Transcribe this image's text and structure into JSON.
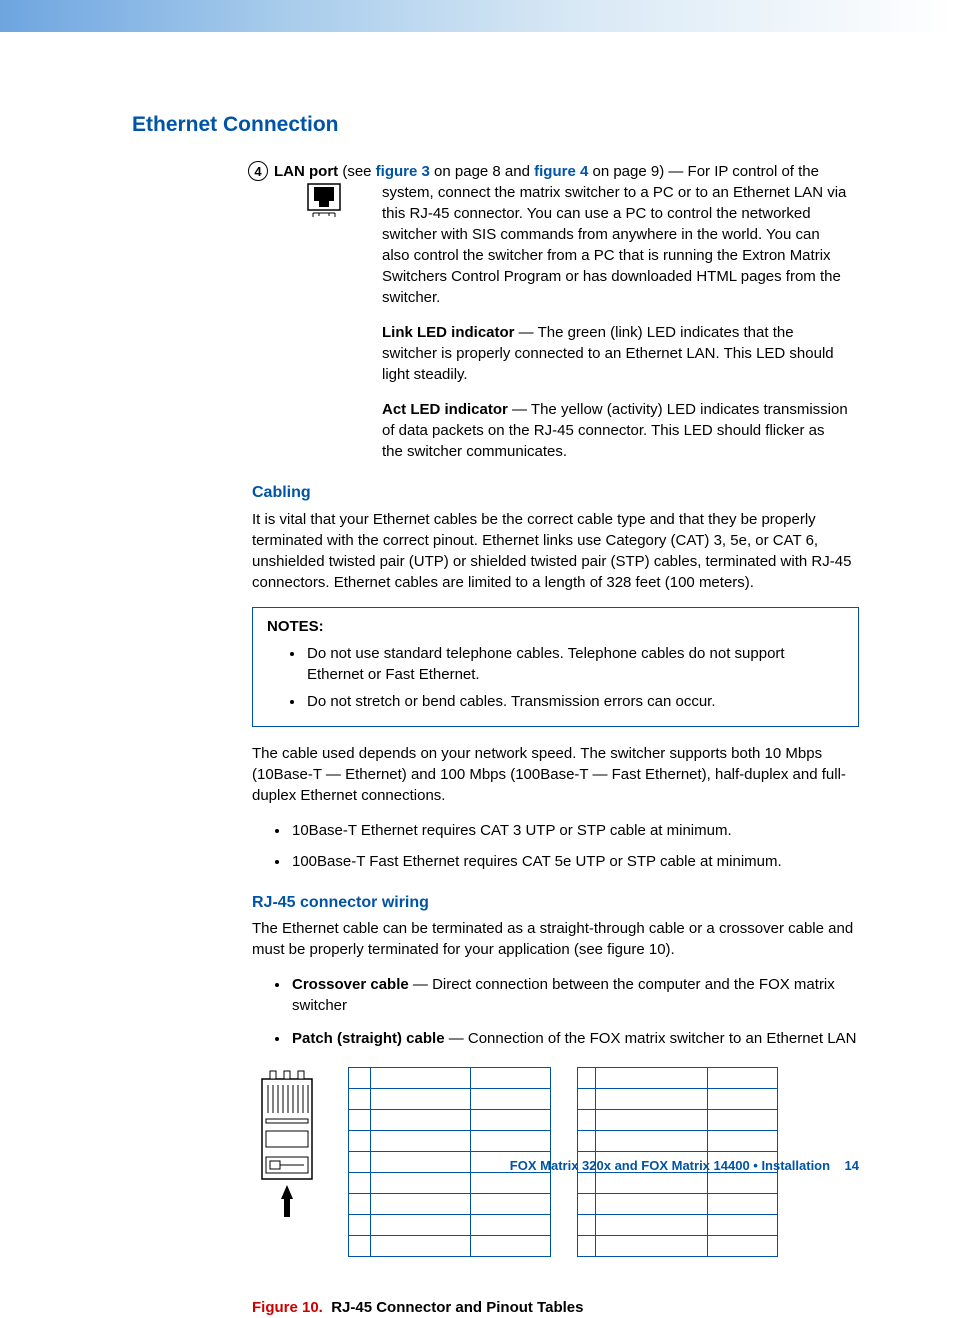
{
  "heading": "Ethernet Connection",
  "item": {
    "number": "4",
    "label": "LAN port",
    "intro_prefix": " (see ",
    "fig3": "figure 3",
    "mid1": " on page 8 and ",
    "fig4": "figure 4",
    "intro_suffix": " on page 9) — For IP control of the",
    "desc_rest": "system, connect the matrix switcher to a PC or to an Ethernet LAN via this RJ-45 connector. You can use a PC to control the networked switcher with SIS commands from anywhere in the world. You can also control the switcher from a PC that is running the Extron Matrix Switchers Control Program or has downloaded HTML pages from the switcher.",
    "link_led_label": "Link LED indicator",
    "link_led_text": " — The green (link) LED indicates that the switcher is properly connected to an Ethernet LAN. This LED should light steadily.",
    "act_led_label": "Act LED indicator",
    "act_led_text": " — The yellow (activity) LED indicates transmission of data packets on the RJ-45 connector. This LED should flicker as the switcher communicates."
  },
  "cabling": {
    "heading": "Cabling",
    "para": "It is vital that your Ethernet cables be the correct cable type and that they be properly terminated with the correct pinout. Ethernet links use Category (CAT) 3, 5e, or CAT 6, unshielded twisted pair (UTP) or shielded twisted pair (STP) cables, terminated with RJ-45 connectors. Ethernet cables are limited to a length of 328 feet (100 meters).",
    "notes_label": "NOTES:",
    "notes": [
      "Do not use standard telephone cables. Telephone cables do not support Ethernet or Fast Ethernet.",
      "Do not stretch or bend cables. Transmission errors can occur."
    ],
    "speed_para": "The cable used depends on your network speed. The switcher supports both 10 Mbps (10Base-T — Ethernet) and 100 Mbps (100Base-T — Fast Ethernet), half-duplex and full-duplex Ethernet connections.",
    "speed_bullets": [
      "10Base-T Ethernet requires CAT 3 UTP or STP cable at minimum.",
      "100Base-T Fast Ethernet requires CAT 5e UTP or STP cable at minimum."
    ]
  },
  "rj45": {
    "heading": "RJ-45 connector wiring",
    "para": "The Ethernet cable can be terminated as a straight-through cable or a crossover cable and must be properly terminated for your application (see figure 10).",
    "bullets": [
      {
        "label": "Crossover cable",
        "text": " — Direct connection between the computer and the FOX matrix switcher"
      },
      {
        "label": "Patch (straight) cable",
        "text": " — Connection of the FOX matrix switcher to an Ethernet LAN"
      }
    ],
    "figure_label": "Figure 10.",
    "figure_title": "RJ-45 Connector and Pinout Tables"
  },
  "footer": {
    "title": "FOX Matrix 320x and FOX Matrix 14400 • Installation",
    "page": "14"
  }
}
